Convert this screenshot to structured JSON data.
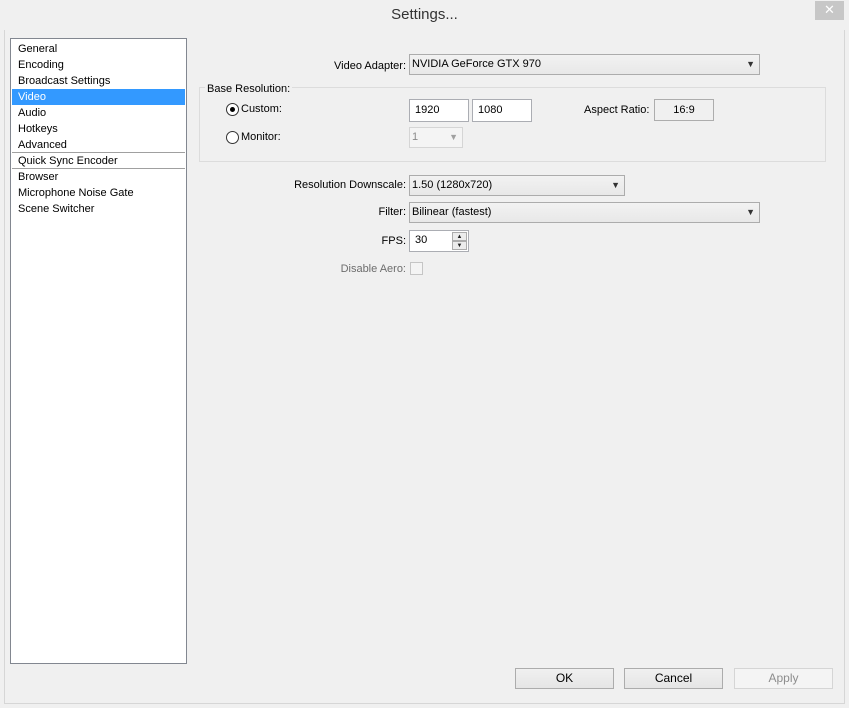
{
  "window": {
    "title": "Settings...",
    "close_glyph": "✕"
  },
  "sidebar": {
    "items": [
      {
        "label": "General"
      },
      {
        "label": "Encoding"
      },
      {
        "label": "Broadcast Settings"
      },
      {
        "label": "Video",
        "selected": true
      },
      {
        "label": "Audio"
      },
      {
        "label": "Hotkeys"
      },
      {
        "label": "Advanced"
      },
      {
        "label": "Quick Sync Encoder"
      },
      {
        "label": "Browser"
      },
      {
        "label": "Microphone Noise Gate"
      },
      {
        "label": "Scene Switcher"
      }
    ],
    "selected_color": "#3399ff"
  },
  "video": {
    "adapter_label": "Video Adapter:",
    "adapter_value": "NVIDIA GeForce GTX 970",
    "base_resolution": {
      "title": "Base Resolution:",
      "custom_label": "Custom:",
      "custom_selected": true,
      "width": "1920",
      "height": "1080",
      "aspect_label": "Aspect Ratio:",
      "aspect_value": "16:9",
      "monitor_label": "Monitor:",
      "monitor_value": "1"
    },
    "downscale_label": "Resolution Downscale:",
    "downscale_value": "1.50  (1280x720)",
    "filter_label": "Filter:",
    "filter_value": "Bilinear (fastest)",
    "fps_label": "FPS:",
    "fps_value": "30",
    "disable_aero_label": "Disable Aero:",
    "disable_aero_checked": false
  },
  "buttons": {
    "ok": "OK",
    "cancel": "Cancel",
    "apply": "Apply"
  },
  "icons": {
    "dropdown": "▼",
    "spin_up": "▲",
    "spin_down": "▼"
  }
}
